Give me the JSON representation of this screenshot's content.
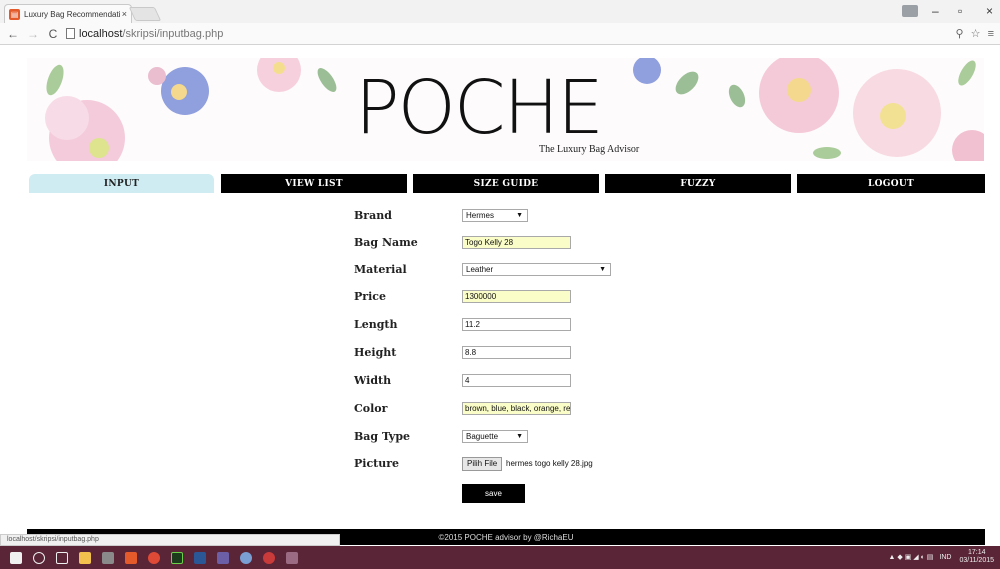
{
  "browser": {
    "tab_title": "Luxury Bag Recommendation",
    "tab_close": "×",
    "url_host": "localhost",
    "url_path": "/skripsi/inputbag.php",
    "status_url": "localhost/skripsi/inputbag.php"
  },
  "brand": {
    "logo": "POCHE",
    "tagline": "The Luxury Bag Advisor"
  },
  "nav": {
    "items": [
      "INPUT",
      "VIEW LIST",
      "SIZE GUIDE",
      "FUZZY",
      "LOGOUT"
    ],
    "active": "INPUT"
  },
  "form": {
    "brand_label": "Brand",
    "brand_value": "Hermes",
    "bag_name_label": "Bag Name",
    "bag_name_value": "Togo Kelly 28",
    "material_label": "Material",
    "material_value": "Leather",
    "price_label": "Price",
    "price_value": "1300000",
    "length_label": "Length",
    "length_value": "11.2",
    "height_label": "Height",
    "height_value": "8.8",
    "width_label": "Width",
    "width_value": "4",
    "color_label": "Color",
    "color_value": "brown, blue, black, orange, re",
    "bag_type_label": "Bag Type",
    "bag_type_value": "Baguette",
    "picture_label": "Picture",
    "file_button": "Pilih File",
    "file_name": "hermes togo kelly 28.jpg",
    "save_label": "save"
  },
  "footer": {
    "text": "©2015 POCHE advisor by @RichaEU"
  },
  "taskbar": {
    "lang": "IND",
    "time": "17:14",
    "date": "03/11/2015"
  },
  "colors": {
    "nav_active": "#cfecf2",
    "nav_bg": "#000000",
    "field_highlight": "#fafdc7",
    "taskbar": "#5a2536"
  }
}
